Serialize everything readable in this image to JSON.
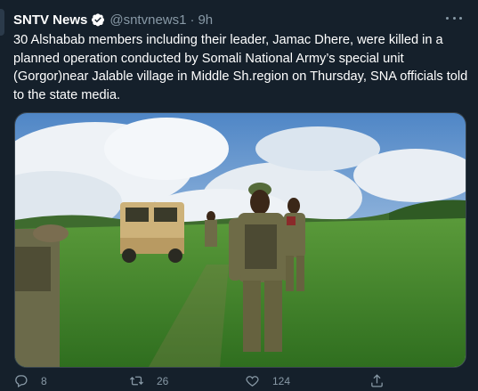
{
  "tweet": {
    "author_name": "SNTV News",
    "handle": "@sntvnews1",
    "separator": "·",
    "time": "9h",
    "text": "30 Alshabab members including their leader,  Jamac Dhere, were killed in a planned operation conducted by Somali National Army’s special unit (Gorgor)near Jalable village in Middle Sh.region on Thursday, SNA officials told to the state media.",
    "actions": {
      "reply_count": "8",
      "retweet_count": "26",
      "like_count": "124"
    }
  },
  "colors": {
    "background": "#15202b",
    "secondary_text": "#8899a6",
    "verified": "#ffffff",
    "border": "#38444d"
  },
  "icons": [
    "verified-badge-icon",
    "more-icon",
    "reply-icon",
    "retweet-icon",
    "like-icon",
    "share-icon"
  ]
}
